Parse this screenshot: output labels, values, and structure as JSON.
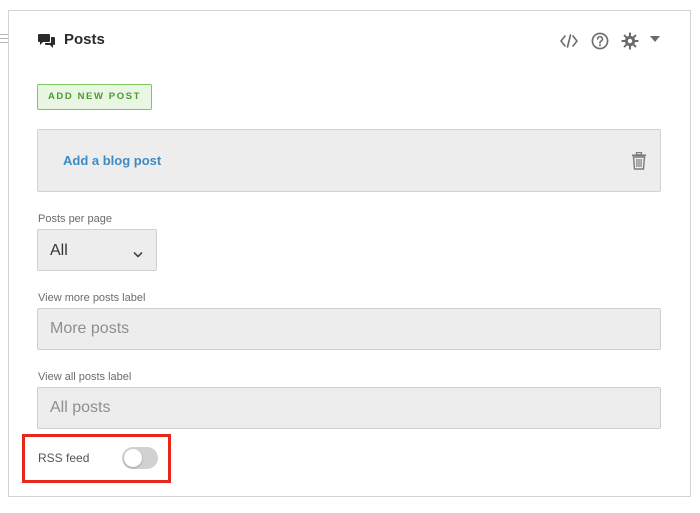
{
  "header": {
    "title": "Posts",
    "icons": [
      "posts-icon",
      "code-icon",
      "help-icon",
      "gear-icon",
      "triangle-down-icon"
    ]
  },
  "actions": {
    "add_new_post_label": "ADD NEW POST"
  },
  "posts": [
    {
      "label": "Add a blog post",
      "delete_icon": "trash-icon"
    }
  ],
  "fields": {
    "posts_per_page": {
      "label": "Posts per page",
      "value": "All"
    },
    "view_more_label": {
      "label": "View more posts label",
      "placeholder": "More posts"
    },
    "view_all_label": {
      "label": "View all posts label",
      "placeholder": "All posts"
    },
    "rss_feed": {
      "label": "RSS feed",
      "enabled": false
    }
  },
  "colors": {
    "accent_green": "#7cc85e",
    "link_blue": "#3d8bc2",
    "highlight_red": "#e6271c"
  }
}
